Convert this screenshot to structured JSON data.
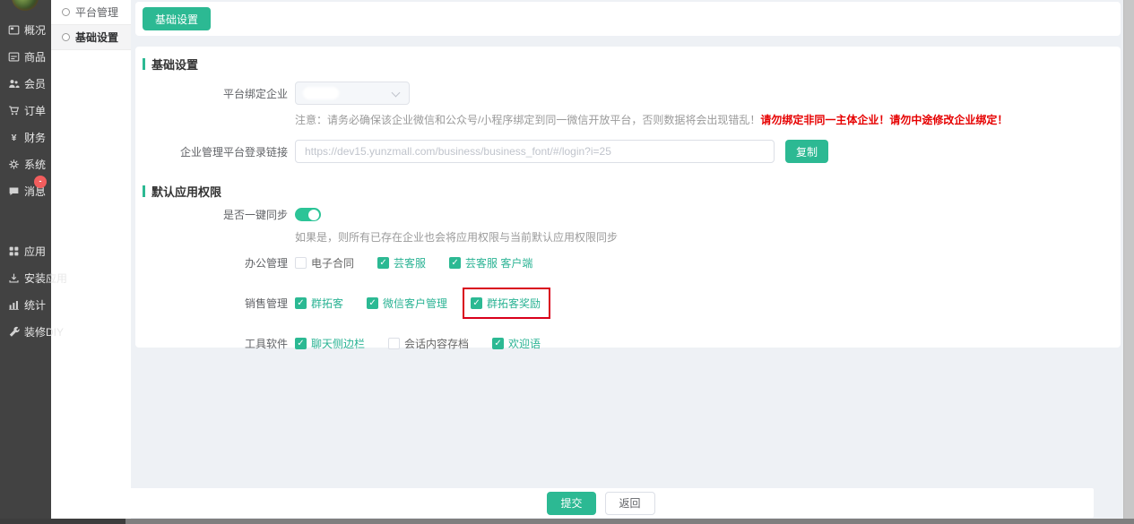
{
  "accent": "#2cb993",
  "sidebar": {
    "items": [
      {
        "id": "overview",
        "label": "概况",
        "icon": "overview-icon"
      },
      {
        "id": "goods",
        "label": "商品",
        "icon": "goods-icon"
      },
      {
        "id": "members",
        "label": "会员",
        "icon": "members-icon"
      },
      {
        "id": "orders",
        "label": "订单",
        "icon": "orders-icon"
      },
      {
        "id": "finance",
        "label": "财务",
        "icon": "finance-icon"
      },
      {
        "id": "system",
        "label": "系统",
        "icon": "system-icon"
      },
      {
        "id": "messages",
        "label": "消息",
        "icon": "message-icon",
        "badge": "-"
      },
      {
        "id": "apps",
        "label": "应用",
        "icon": "apps-icon",
        "gap_before": true
      },
      {
        "id": "install-apps",
        "label": "安装应用",
        "icon": "install-icon"
      },
      {
        "id": "stats",
        "label": "统计",
        "icon": "stats-icon"
      },
      {
        "id": "decorate-diy",
        "label": "装修DIY",
        "icon": "diy-icon"
      }
    ]
  },
  "submenu": {
    "items": [
      {
        "id": "platform-manage",
        "label": "平台管理",
        "selected": false
      },
      {
        "id": "basic-settings",
        "label": "基础设置",
        "selected": true
      }
    ]
  },
  "header": {
    "tab_label": "基础设置"
  },
  "form": {
    "section1_title": "基础设置",
    "bind_label": "平台绑定企业",
    "bind_note_gray": "注意：请务必确保该企业微信和公众号/小程序绑定到同一微信开放平台，否则数据将会出现错乱！",
    "bind_note_red": "请勿绑定非同一主体企业！请勿中途修改企业绑定！",
    "login_link_label": "企业管理平台登录链接",
    "login_link_value": "https://dev15.yunzmall.com/business/business_font/#/login?i=25",
    "copy_button": "复制",
    "section2_title": "默认应用权限",
    "sync_label": "是否一键同步",
    "sync_on": true,
    "sync_note": "如果是，则所有已存在企业也会将应用权限与当前默认应用权限同步",
    "permission_groups": [
      {
        "id": "office",
        "label": "办公管理",
        "options": [
          {
            "name": "电子合同",
            "checked": false
          },
          {
            "name": "芸客服",
            "checked": true
          },
          {
            "name": "芸客服 客户端",
            "checked": true
          }
        ]
      },
      {
        "id": "sales",
        "label": "销售管理",
        "options": [
          {
            "name": "群拓客",
            "checked": true
          },
          {
            "name": "微信客户管理",
            "checked": true
          },
          {
            "name": "群拓客奖励",
            "checked": true,
            "highlighted": true
          }
        ]
      },
      {
        "id": "tools",
        "label": "工具软件",
        "options": [
          {
            "name": "聊天侧边栏",
            "checked": true
          },
          {
            "name": "会话内容存档",
            "checked": false
          },
          {
            "name": "欢迎语",
            "checked": true
          }
        ]
      }
    ]
  },
  "footer": {
    "submit_label": "提交",
    "back_label": "返回"
  }
}
